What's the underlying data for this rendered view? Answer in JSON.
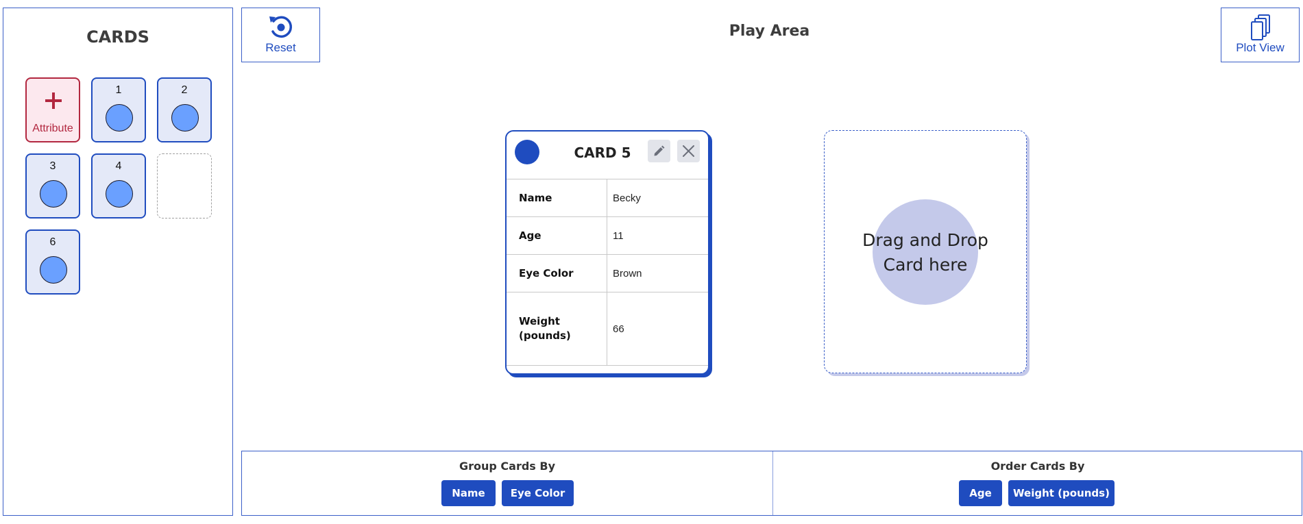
{
  "sidebar": {
    "title": "CARDS",
    "add_label": "Attribute",
    "cards": [
      {
        "number": "1"
      },
      {
        "number": "2"
      },
      {
        "number": "3"
      },
      {
        "number": "4"
      },
      {
        "number": "6"
      }
    ],
    "colors": {
      "card_border": "#1f4cbf",
      "card_fill": "#e4e9f8",
      "dot": "#6aa0ff",
      "add_accent": "#b2273f"
    }
  },
  "toolbar": {
    "reset_label": "Reset",
    "plot_view_label": "Plot View"
  },
  "play_area": {
    "title": "Play Area",
    "active_card": {
      "title": "CARD 5",
      "color": "#1f4cbf",
      "edit_icon": "pencil-icon",
      "close_icon": "close-icon",
      "attributes": [
        {
          "name": "Name",
          "value": "Becky"
        },
        {
          "name": "Age",
          "value": "11"
        },
        {
          "name": "Eye Color",
          "value": "Brown"
        },
        {
          "name": "Weight (pounds)",
          "value": "66"
        }
      ]
    },
    "drop_zone": {
      "line1": "Drag and Drop",
      "line2": "Card here"
    }
  },
  "controls": {
    "group": {
      "title": "Group Cards By",
      "options": [
        "Name",
        "Eye Color"
      ]
    },
    "order": {
      "title": "Order Cards By",
      "options": [
        "Age",
        "Weight (pounds)"
      ]
    }
  }
}
